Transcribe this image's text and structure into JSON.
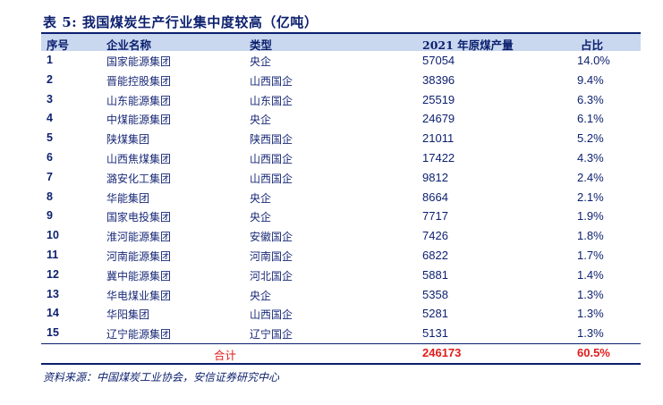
{
  "title": "表 5:  我国煤炭生产行业集中度较高（亿吨）",
  "headers": {
    "no": "序号",
    "name": "企业名称",
    "type": "类型",
    "output": "2021 年原煤产量",
    "share": "占比"
  },
  "rows": [
    {
      "no": "1",
      "name": "国家能源集团",
      "type": "央企",
      "output": "57054",
      "share": "14.0%"
    },
    {
      "no": "2",
      "name": "晋能控股集团",
      "type": "山西国企",
      "output": "38396",
      "share": "9.4%"
    },
    {
      "no": "3",
      "name": "山东能源集团",
      "type": "山东国企",
      "output": "25519",
      "share": "6.3%"
    },
    {
      "no": "4",
      "name": "中煤能源集团",
      "type": "央企",
      "output": "24679",
      "share": "6.1%"
    },
    {
      "no": "5",
      "name": "陕煤集团",
      "type": "陕西国企",
      "output": "21011",
      "share": "5.2%"
    },
    {
      "no": "6",
      "name": "山西焦煤集团",
      "type": "山西国企",
      "output": "17422",
      "share": "4.3%"
    },
    {
      "no": "7",
      "name": "潞安化工集团",
      "type": "山西国企",
      "output": "9812",
      "share": "2.4%"
    },
    {
      "no": "8",
      "name": "华能集团",
      "type": "央企",
      "output": "8664",
      "share": "2.1%"
    },
    {
      "no": "9",
      "name": "国家电投集团",
      "type": "央企",
      "output": "7717",
      "share": "1.9%"
    },
    {
      "no": "10",
      "name": "淮河能源集团",
      "type": "安徽国企",
      "output": "7426",
      "share": "1.8%"
    },
    {
      "no": "11",
      "name": "河南能源集团",
      "type": "河南国企",
      "output": "6822",
      "share": "1.7%"
    },
    {
      "no": "12",
      "name": "冀中能源集团",
      "type": "河北国企",
      "output": "5881",
      "share": "1.4%"
    },
    {
      "no": "13",
      "name": "华电煤业集团",
      "type": "央企",
      "output": "5358",
      "share": "1.3%"
    },
    {
      "no": "14",
      "name": "华阳集团",
      "type": "山西国企",
      "output": "5281",
      "share": "1.3%"
    },
    {
      "no": "15",
      "name": "辽宁能源集团",
      "type": "辽宁国企",
      "output": "5131",
      "share": "1.3%"
    }
  ],
  "total": {
    "label": "合计",
    "output": "246173",
    "share": "60.5%"
  },
  "source": "资料来源：中国煤炭工业协会，安信证券研究中心",
  "colors": {
    "text": "#0b1f6e",
    "header_bg": "#c9d7ef",
    "total": "#e21b1b"
  }
}
